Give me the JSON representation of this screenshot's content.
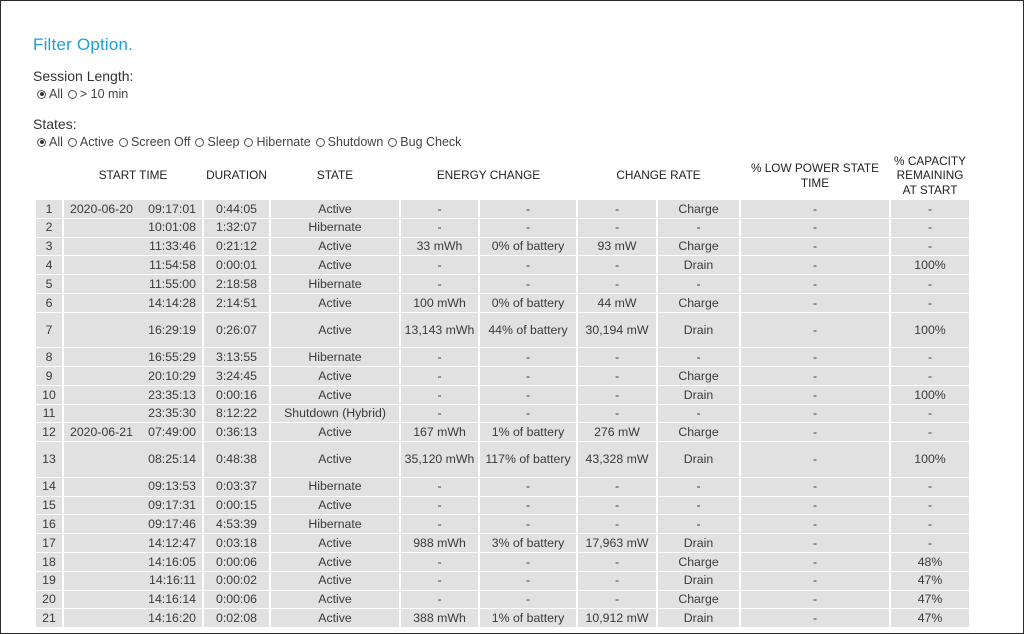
{
  "title": "Filter Option.",
  "session_length": {
    "label": "Session Length:",
    "options": [
      {
        "label": "All",
        "checked": true
      },
      {
        "label": "> 10 min",
        "checked": false
      }
    ]
  },
  "states": {
    "label": "States:",
    "options": [
      {
        "label": "All",
        "checked": true
      },
      {
        "label": "Active",
        "checked": false
      },
      {
        "label": "Screen Off",
        "checked": false
      },
      {
        "label": "Sleep",
        "checked": false
      },
      {
        "label": "Hibernate",
        "checked": false
      },
      {
        "label": "Shutdown",
        "checked": false
      },
      {
        "label": "Bug Check",
        "checked": false
      }
    ]
  },
  "table": {
    "headers": [
      "",
      "START TIME",
      "DURATION",
      "STATE",
      "ENERGY CHANGE",
      "",
      "CHANGE RATE",
      "",
      "% LOW POWER STATE TIME",
      "% CAPACITY REMAINING AT START"
    ],
    "rows": [
      {
        "n": "1",
        "date": "2020-06-20",
        "time": "09:17:01",
        "duration": "0:44:05",
        "state": "Active",
        "energy": "-",
        "pct": "-",
        "rate": "-",
        "dir": "Charge",
        "low": "-",
        "cap": "-"
      },
      {
        "n": "2",
        "date": "",
        "time": "10:01:08",
        "duration": "1:32:07",
        "state": "Hibernate",
        "energy": "-",
        "pct": "-",
        "rate": "-",
        "dir": "-",
        "low": "-",
        "cap": "-"
      },
      {
        "n": "3",
        "date": "",
        "time": "11:33:46",
        "duration": "0:21:12",
        "state": "Active",
        "energy": "33 mWh",
        "pct": "0% of battery",
        "rate": "93 mW",
        "dir": "Charge",
        "low": "-",
        "cap": "-"
      },
      {
        "n": "4",
        "date": "",
        "time": "11:54:58",
        "duration": "0:00:01",
        "state": "Active",
        "energy": "-",
        "pct": "-",
        "rate": "-",
        "dir": "Drain",
        "low": "-",
        "cap": "100%"
      },
      {
        "n": "5",
        "date": "",
        "time": "11:55:00",
        "duration": "2:18:58",
        "state": "Hibernate",
        "energy": "-",
        "pct": "-",
        "rate": "-",
        "dir": "-",
        "low": "-",
        "cap": "-"
      },
      {
        "n": "6",
        "date": "",
        "time": "14:14:28",
        "duration": "2:14:51",
        "state": "Active",
        "energy": "100 mWh",
        "pct": "0% of battery",
        "rate": "44 mW",
        "dir": "Charge",
        "low": "-",
        "cap": "-"
      },
      {
        "n": "7",
        "date": "",
        "time": "16:29:19",
        "duration": "0:26:07",
        "state": "Active",
        "energy": "13,143 mWh",
        "pct": "44% of battery",
        "rate": "30,194 mW",
        "dir": "Drain",
        "low": "-",
        "cap": "100%",
        "tall": true
      },
      {
        "n": "8",
        "date": "",
        "time": "16:55:29",
        "duration": "3:13:55",
        "state": "Hibernate",
        "energy": "-",
        "pct": "-",
        "rate": "-",
        "dir": "-",
        "low": "-",
        "cap": "-"
      },
      {
        "n": "9",
        "date": "",
        "time": "20:10:29",
        "duration": "3:24:45",
        "state": "Active",
        "energy": "-",
        "pct": "-",
        "rate": "-",
        "dir": "Charge",
        "low": "-",
        "cap": "-"
      },
      {
        "n": "10",
        "date": "",
        "time": "23:35:13",
        "duration": "0:00:16",
        "state": "Active",
        "energy": "-",
        "pct": "-",
        "rate": "-",
        "dir": "Drain",
        "low": "-",
        "cap": "100%"
      },
      {
        "n": "11",
        "date": "",
        "time": "23:35:30",
        "duration": "8:12:22",
        "state": "Shutdown (Hybrid)",
        "energy": "-",
        "pct": "-",
        "rate": "-",
        "dir": "-",
        "low": "-",
        "cap": "-"
      },
      {
        "n": "12",
        "date": "2020-06-21",
        "time": "07:49:00",
        "duration": "0:36:13",
        "state": "Active",
        "energy": "167 mWh",
        "pct": "1% of battery",
        "rate": "276 mW",
        "dir": "Charge",
        "low": "-",
        "cap": "-"
      },
      {
        "n": "13",
        "date": "",
        "time": "08:25:14",
        "duration": "0:48:38",
        "state": "Active",
        "energy": "35,120 mWh",
        "pct": "117% of battery",
        "rate": "43,328 mW",
        "dir": "Drain",
        "low": "-",
        "cap": "100%",
        "tall": true
      },
      {
        "n": "14",
        "date": "",
        "time": "09:13:53",
        "duration": "0:03:37",
        "state": "Hibernate",
        "energy": "-",
        "pct": "-",
        "rate": "-",
        "dir": "-",
        "low": "-",
        "cap": "-"
      },
      {
        "n": "15",
        "date": "",
        "time": "09:17:31",
        "duration": "0:00:15",
        "state": "Active",
        "energy": "-",
        "pct": "-",
        "rate": "-",
        "dir": "-",
        "low": "-",
        "cap": "-"
      },
      {
        "n": "16",
        "date": "",
        "time": "09:17:46",
        "duration": "4:53:39",
        "state": "Hibernate",
        "energy": "-",
        "pct": "-",
        "rate": "-",
        "dir": "-",
        "low": "-",
        "cap": "-"
      },
      {
        "n": "17",
        "date": "",
        "time": "14:12:47",
        "duration": "0:03:18",
        "state": "Active",
        "energy": "988 mWh",
        "pct": "3% of battery",
        "rate": "17,963 mW",
        "dir": "Drain",
        "low": "-",
        "cap": "-"
      },
      {
        "n": "18",
        "date": "",
        "time": "14:16:05",
        "duration": "0:00:06",
        "state": "Active",
        "energy": "-",
        "pct": "-",
        "rate": "-",
        "dir": "Charge",
        "low": "-",
        "cap": "48%"
      },
      {
        "n": "19",
        "date": "",
        "time": "14:16:11",
        "duration": "0:00:02",
        "state": "Active",
        "energy": "-",
        "pct": "-",
        "rate": "-",
        "dir": "Drain",
        "low": "-",
        "cap": "47%"
      },
      {
        "n": "20",
        "date": "",
        "time": "14:16:14",
        "duration": "0:00:06",
        "state": "Active",
        "energy": "-",
        "pct": "-",
        "rate": "-",
        "dir": "Charge",
        "low": "-",
        "cap": "47%"
      },
      {
        "n": "21",
        "date": "",
        "time": "14:16:20",
        "duration": "0:02:08",
        "state": "Active",
        "energy": "388 mWh",
        "pct": "1% of battery",
        "rate": "10,912 mW",
        "dir": "Drain",
        "low": "-",
        "cap": "47%"
      }
    ]
  }
}
